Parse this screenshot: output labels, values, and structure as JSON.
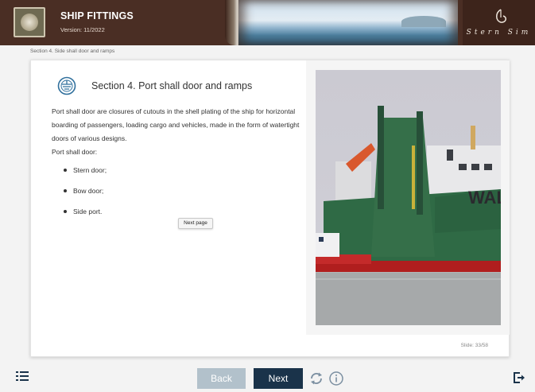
{
  "header": {
    "title": "SHIP FITTINGS",
    "version": "Version: 11/2022",
    "brand_name": "Stern Sim",
    "colors": {
      "header_bg": "#4a2e24",
      "brand_bg": "#3d241b"
    }
  },
  "breadcrumb": "Section 4. Side shall door and ramps",
  "content": {
    "section_icon": "ship-wheel-icon",
    "title": "Section 4. Port shall door and ramps",
    "intro": "Port shall door are closures of cutouts in the shell plating of the ship for horizontal boarding of passengers, loading cargo and vehicles, made in the form of watertight doors of various designs.",
    "list_label": "Port shall door:",
    "items": [
      "Stern door;",
      "Bow door;",
      "Side port."
    ],
    "tooltip": "Next page",
    "image_text": "WALL"
  },
  "slide_counter": "Slide: 33/58",
  "nav": {
    "back_label": "Back",
    "next_label": "Next",
    "colors": {
      "back": "#b2c1cb",
      "next": "#1a334a"
    },
    "icons": [
      "menu-list-icon",
      "reload-icon",
      "info-icon",
      "exit-icon"
    ]
  }
}
